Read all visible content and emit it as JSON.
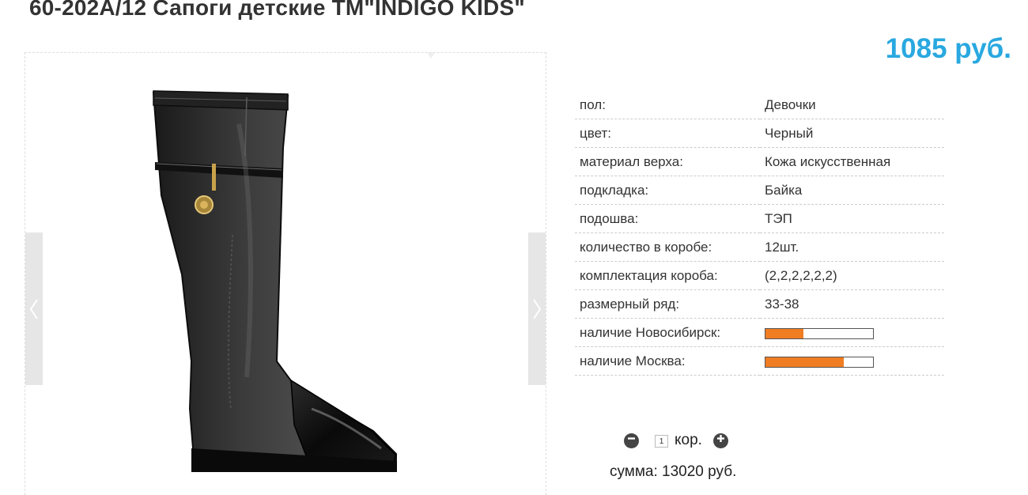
{
  "product": {
    "title": "60-202A/12 Сапоги детские ТМ\"INDIGO KIDS\"",
    "price": "1085 руб."
  },
  "gallery": {
    "prev_icon": "chevron-left-icon",
    "next_icon": "chevron-right-icon",
    "image": "black-kids-boot-image"
  },
  "specs": [
    {
      "label": "пол:",
      "value": "Девочки"
    },
    {
      "label": "цвет:",
      "value": "Черный"
    },
    {
      "label": "материал верха:",
      "value": "Кожа искусственная"
    },
    {
      "label": "подкладка:",
      "value": "Байка"
    },
    {
      "label": "подошва:",
      "value": "ТЭП"
    },
    {
      "label": "количество в коробе:",
      "value": "12шт."
    },
    {
      "label": "комплектация короба:",
      "value": "(2,2,2,2,2,2)"
    },
    {
      "label": "размерный ряд:",
      "value": "33-38"
    }
  ],
  "stock": [
    {
      "label": "наличие Новосибирск:",
      "level_percent": 35
    },
    {
      "label": "наличие Москва:",
      "level_percent": 73
    }
  ],
  "order": {
    "quantity": "1",
    "unit": "кор.",
    "sum_label": "сумма: 13020 руб.",
    "minus_icon": "minus-circle-icon",
    "plus_icon": "plus-circle-icon"
  },
  "colors": {
    "price": "#29a8e0",
    "stock_fill": "#f07d22",
    "arrow_bg": "#e6e6e6"
  }
}
